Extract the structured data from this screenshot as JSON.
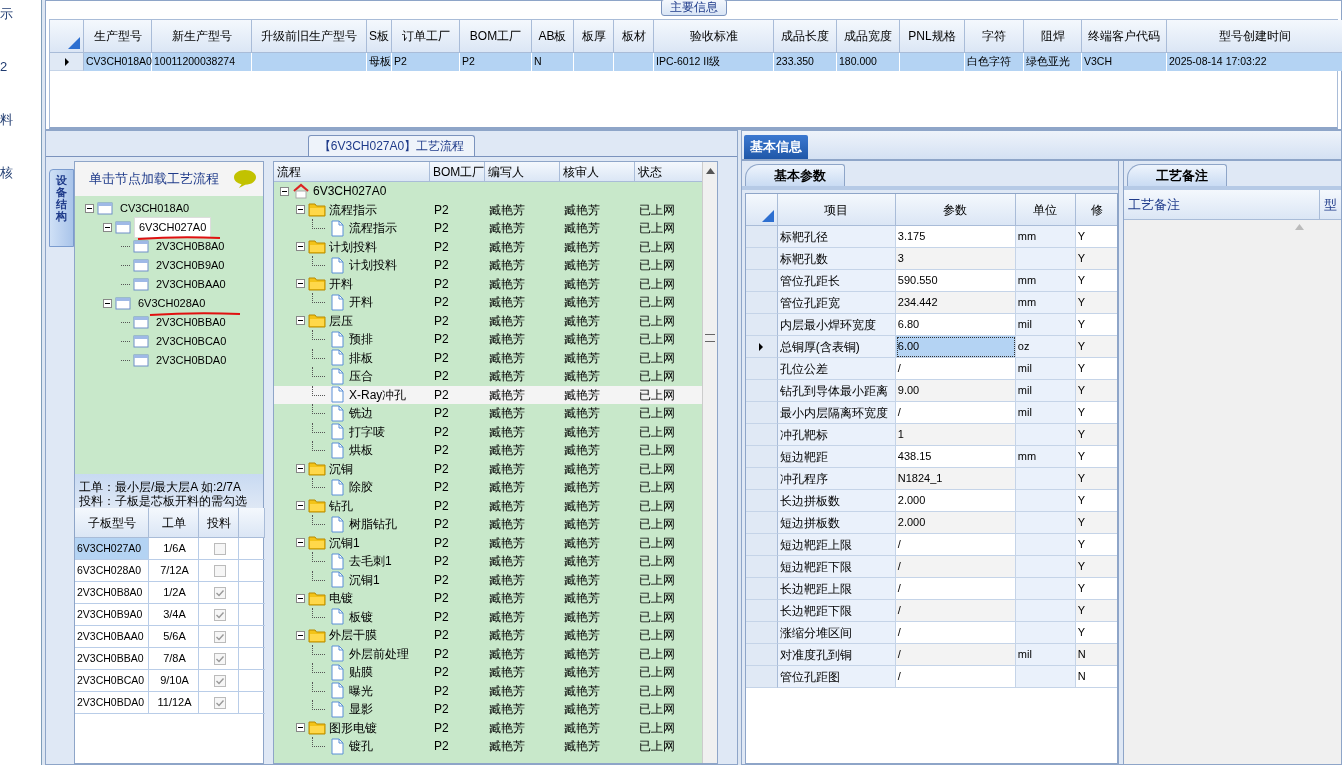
{
  "left_nav": [
    {
      "label": "示"
    },
    {
      "label": "2"
    },
    {
      "label": "料"
    },
    {
      "label": "核"
    }
  ],
  "main_info": {
    "title": "主要信息",
    "columns": [
      "生产型号",
      "新生产型号",
      "升级前旧生产型号",
      "S板",
      "订单工厂",
      "BOM工厂",
      "AB板",
      "板厚",
      "板材",
      "验收标准",
      "成品长度",
      "成品宽度",
      "PNL规格",
      "字符",
      "阻焊",
      "终端客户代码",
      "型号创建时间"
    ],
    "rows": [
      {
        "selected": true,
        "cells": [
          "CV3CH018A0",
          "10011200038274",
          null,
          "母板",
          "P2",
          "P2",
          "N",
          null,
          null,
          "IPC-6012 II级",
          "233.350",
          "180.000",
          null,
          "白色字符",
          "绿色亚光",
          "V3CH",
          "2025-08-14 17:03:22"
        ]
      }
    ]
  },
  "process": {
    "title": "【6V3CH027A0】工艺流程",
    "side_tab": "设备结构",
    "tree_header": "单击节点加载工艺流程",
    "tree": [
      {
        "label": "CV3CH018A0",
        "selected": false,
        "expanded": true,
        "children": [
          {
            "label": "6V3CH027A0",
            "selected": true,
            "expanded": true,
            "children": [
              {
                "label": "2V3CH0B8A0",
                "selected": false
              },
              {
                "label": "2V3CH0B9A0",
                "selected": false
              },
              {
                "label": "2V3CH0BAA0",
                "selected": false
              }
            ]
          },
          {
            "label": "6V3CH028A0",
            "selected": false,
            "expanded": true,
            "children": [
              {
                "label": "2V3CH0BBA0",
                "selected": false
              },
              {
                "label": "2V3CH0BCA0",
                "selected": false
              },
              {
                "label": "2V3CH0BDA0",
                "selected": false
              }
            ]
          }
        ]
      }
    ],
    "note_lines": [
      "工单：最小层/最大层A 如:2/7A",
      "投料：子板是芯板开料的需勾选"
    ],
    "sub_table": {
      "columns": [
        "子板型号",
        "工单",
        "投料"
      ],
      "rows": [
        {
          "model": "6V3CH027A0",
          "order": "1/6A",
          "checked": false,
          "selected": true
        },
        {
          "model": "6V3CH028A0",
          "order": "7/12A",
          "checked": false,
          "selected": false
        },
        {
          "model": "2V3CH0B8A0",
          "order": "1/2A",
          "checked": true,
          "selected": false
        },
        {
          "model": "2V3CH0B9A0",
          "order": "3/4A",
          "checked": true,
          "selected": false
        },
        {
          "model": "2V3CH0BAA0",
          "order": "5/6A",
          "checked": true,
          "selected": false
        },
        {
          "model": "2V3CH0BBA0",
          "order": "7/8A",
          "checked": true,
          "selected": false
        },
        {
          "model": "2V3CH0BCA0",
          "order": "9/10A",
          "checked": true,
          "selected": false
        },
        {
          "model": "2V3CH0BDA0",
          "order": "11/12A",
          "checked": true,
          "selected": false
        }
      ]
    },
    "flow": {
      "columns": [
        "流程",
        "BOM工厂",
        "编写人",
        "核审人",
        "状态"
      ],
      "tree": [
        {
          "label": "6V3CH027A0",
          "kind": "root",
          "selected": false,
          "expanded": true,
          "children": [
            {
              "label": "流程指示",
              "kind": "folder",
              "expanded": true,
              "selected": false,
              "bom_factory": "P2",
              "writer": "臧艳芳",
              "reviewer": "臧艳芳",
              "status": "已上网",
              "children": [
                {
                  "label": "流程指示",
                  "kind": "step",
                  "selected": false,
                  "bom_factory": "P2",
                  "writer": "臧艳芳",
                  "reviewer": "臧艳芳",
                  "status": "已上网"
                }
              ]
            },
            {
              "label": "计划投料",
              "kind": "folder",
              "expanded": true,
              "selected": false,
              "bom_factory": "P2",
              "writer": "臧艳芳",
              "reviewer": "臧艳芳",
              "status": "已上网",
              "children": [
                {
                  "label": "计划投料",
                  "kind": "step",
                  "selected": false,
                  "bom_factory": "P2",
                  "writer": "臧艳芳",
                  "reviewer": "臧艳芳",
                  "status": "已上网"
                }
              ]
            },
            {
              "label": "开料",
              "kind": "folder",
              "expanded": true,
              "selected": false,
              "bom_factory": "P2",
              "writer": "臧艳芳",
              "reviewer": "臧艳芳",
              "status": "已上网",
              "children": [
                {
                  "label": "开料",
                  "kind": "step",
                  "selected": false,
                  "bom_factory": "P2",
                  "writer": "臧艳芳",
                  "reviewer": "臧艳芳",
                  "status": "已上网"
                }
              ]
            },
            {
              "label": "层压",
              "kind": "folder",
              "expanded": true,
              "selected": false,
              "bom_factory": "P2",
              "writer": "臧艳芳",
              "reviewer": "臧艳芳",
              "status": "已上网",
              "children": [
                {
                  "label": "预排",
                  "kind": "step",
                  "selected": false,
                  "bom_factory": "P2",
                  "writer": "臧艳芳",
                  "reviewer": "臧艳芳",
                  "status": "已上网"
                },
                {
                  "label": "排板",
                  "kind": "step",
                  "selected": false,
                  "bom_factory": "P2",
                  "writer": "臧艳芳",
                  "reviewer": "臧艳芳",
                  "status": "已上网"
                },
                {
                  "label": "压合",
                  "kind": "step",
                  "selected": false,
                  "bom_factory": "P2",
                  "writer": "臧艳芳",
                  "reviewer": "臧艳芳",
                  "status": "已上网"
                },
                {
                  "label": "X-Ray冲孔",
                  "kind": "step",
                  "selected": true,
                  "bom_factory": "P2",
                  "writer": "臧艳芳",
                  "reviewer": "臧艳芳",
                  "status": "已上网"
                },
                {
                  "label": "铣边",
                  "kind": "step",
                  "selected": false,
                  "bom_factory": "P2",
                  "writer": "臧艳芳",
                  "reviewer": "臧艳芳",
                  "status": "已上网"
                },
                {
                  "label": "打字唛",
                  "kind": "step",
                  "selected": false,
                  "bom_factory": "P2",
                  "writer": "臧艳芳",
                  "reviewer": "臧艳芳",
                  "status": "已上网"
                },
                {
                  "label": "烘板",
                  "kind": "step",
                  "selected": false,
                  "bom_factory": "P2",
                  "writer": "臧艳芳",
                  "reviewer": "臧艳芳",
                  "status": "已上网"
                }
              ]
            },
            {
              "label": "沉铜",
              "kind": "folder",
              "expanded": true,
              "selected": false,
              "bom_factory": "P2",
              "writer": "臧艳芳",
              "reviewer": "臧艳芳",
              "status": "已上网",
              "children": [
                {
                  "label": "除胶",
                  "kind": "step",
                  "selected": false,
                  "bom_factory": "P2",
                  "writer": "臧艳芳",
                  "reviewer": "臧艳芳",
                  "status": "已上网"
                }
              ]
            },
            {
              "label": "钻孔",
              "kind": "folder",
              "expanded": true,
              "selected": false,
              "bom_factory": "P2",
              "writer": "臧艳芳",
              "reviewer": "臧艳芳",
              "status": "已上网",
              "children": [
                {
                  "label": "树脂钻孔",
                  "kind": "step",
                  "selected": false,
                  "bom_factory": "P2",
                  "writer": "臧艳芳",
                  "reviewer": "臧艳芳",
                  "status": "已上网"
                }
              ]
            },
            {
              "label": "沉铜1",
              "kind": "folder",
              "expanded": true,
              "selected": false,
              "bom_factory": "P2",
              "writer": "臧艳芳",
              "reviewer": "臧艳芳",
              "status": "已上网",
              "children": [
                {
                  "label": "去毛刺1",
                  "kind": "step",
                  "selected": false,
                  "bom_factory": "P2",
                  "writer": "臧艳芳",
                  "reviewer": "臧艳芳",
                  "status": "已上网"
                },
                {
                  "label": "沉铜1",
                  "kind": "step",
                  "selected": false,
                  "bom_factory": "P2",
                  "writer": "臧艳芳",
                  "reviewer": "臧艳芳",
                  "status": "已上网"
                }
              ]
            },
            {
              "label": "电镀",
              "kind": "folder",
              "expanded": true,
              "selected": false,
              "bom_factory": "P2",
              "writer": "臧艳芳",
              "reviewer": "臧艳芳",
              "status": "已上网",
              "children": [
                {
                  "label": "板镀",
                  "kind": "step",
                  "selected": false,
                  "bom_factory": "P2",
                  "writer": "臧艳芳",
                  "reviewer": "臧艳芳",
                  "status": "已上网"
                }
              ]
            },
            {
              "label": "外层干膜",
              "kind": "folder",
              "expanded": true,
              "selected": false,
              "bom_factory": "P2",
              "writer": "臧艳芳",
              "reviewer": "臧艳芳",
              "status": "已上网",
              "children": [
                {
                  "label": "外层前处理",
                  "kind": "step",
                  "selected": false,
                  "bom_factory": "P2",
                  "writer": "臧艳芳",
                  "reviewer": "臧艳芳",
                  "status": "已上网"
                },
                {
                  "label": "贴膜",
                  "kind": "step",
                  "selected": false,
                  "bom_factory": "P2",
                  "writer": "臧艳芳",
                  "reviewer": "臧艳芳",
                  "status": "已上网"
                },
                {
                  "label": "曝光",
                  "kind": "step",
                  "selected": false,
                  "bom_factory": "P2",
                  "writer": "臧艳芳",
                  "reviewer": "臧艳芳",
                  "status": "已上网"
                },
                {
                  "label": "显影",
                  "kind": "step",
                  "selected": false,
                  "bom_factory": "P2",
                  "writer": "臧艳芳",
                  "reviewer": "臧艳芳",
                  "status": "已上网"
                }
              ]
            },
            {
              "label": "图形电镀",
              "kind": "folder",
              "expanded": true,
              "selected": false,
              "bom_factory": "P2",
              "writer": "臧艳芳",
              "reviewer": "臧艳芳",
              "status": "已上网",
              "children": [
                {
                  "label": "镀孔",
                  "kind": "step",
                  "selected": false,
                  "bom_factory": "P2",
                  "writer": "臧艳芳",
                  "reviewer": "臧艳芳",
                  "status": "已上网"
                }
              ]
            }
          ]
        }
      ]
    }
  },
  "basic": {
    "tab": "基本信息",
    "subtab": "基本参数",
    "columns": [
      "项目",
      "参数",
      "单位",
      "修"
    ],
    "rows": [
      {
        "item": "标靶孔径",
        "param": "3.175",
        "unit": "mm",
        "modify": "Y",
        "selected": false
      },
      {
        "item": "标靶孔数",
        "param": "3",
        "modify": "Y",
        "selected": false
      },
      {
        "item": "管位孔距长",
        "param": "590.550",
        "unit": "mm",
        "modify": "Y",
        "selected": false
      },
      {
        "item": "管位孔距宽",
        "param": "234.442",
        "unit": "mm",
        "modify": "Y",
        "selected": false
      },
      {
        "item": "内层最小焊环宽度",
        "param": "6.80",
        "unit": "mil",
        "modify": "Y",
        "selected": false
      },
      {
        "item": "总铜厚(含表铜)",
        "param": "6.00",
        "unit": "oz",
        "modify": "Y",
        "selected": true
      },
      {
        "item": "孔位公差",
        "param": "/",
        "unit": "mil",
        "modify": "Y",
        "selected": false
      },
      {
        "item": "钻孔到导体最小距离",
        "param": "9.00",
        "unit": "mil",
        "modify": "Y",
        "selected": false
      },
      {
        "item": "最小内层隔离环宽度",
        "param": "/",
        "unit": "mil",
        "modify": "Y",
        "selected": false
      },
      {
        "item": "冲孔靶标",
        "param": "1",
        "modify": "Y",
        "selected": false
      },
      {
        "item": "短边靶距",
        "param": "438.15",
        "unit": "mm",
        "modify": "Y",
        "selected": false
      },
      {
        "item": "冲孔程序",
        "param": "N1824_1",
        "modify": "Y",
        "selected": false
      },
      {
        "item": "长边拼板数",
        "param": "2.000",
        "modify": "Y",
        "selected": false
      },
      {
        "item": "短边拼板数",
        "param": "2.000",
        "modify": "Y",
        "selected": false
      },
      {
        "item": "短边靶距上限",
        "param": "/",
        "modify": "Y",
        "selected": false
      },
      {
        "item": "短边靶距下限",
        "param": "/",
        "modify": "Y",
        "selected": false
      },
      {
        "item": "长边靶距上限",
        "param": "/",
        "modify": "Y",
        "selected": false
      },
      {
        "item": "长边靶距下限",
        "param": "/",
        "modify": "Y",
        "selected": false
      },
      {
        "item": "涨缩分堆区间",
        "param": "/",
        "modify": "Y",
        "selected": false
      },
      {
        "item": "对准度孔到铜",
        "param": "/",
        "unit": "mil",
        "modify": "N",
        "selected": false
      },
      {
        "item": "管位孔距图",
        "param": "/",
        "modify": "N",
        "selected": false
      }
    ]
  },
  "remarks": {
    "tab": "工艺备注",
    "columns": [
      "工艺备注",
      "型"
    ]
  }
}
